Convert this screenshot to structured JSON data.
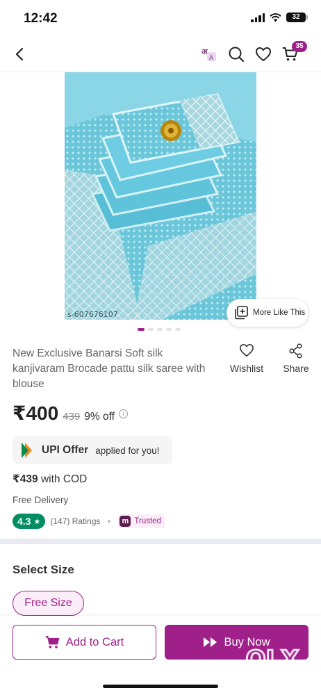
{
  "status_bar": {
    "time": "12:42",
    "battery": "32"
  },
  "header": {
    "cart_count": "35",
    "lang_icon": "language-icon"
  },
  "image": {
    "code": "s-607676107",
    "more_like_label": "More Like This"
  },
  "carousel": {
    "count": 5,
    "active": 0
  },
  "product": {
    "title": "New Exclusive Banarsi Soft silk kanjivaram Brocade pattu silk saree with blouse",
    "price": "₹400",
    "mrp": "439",
    "discount": "9% off"
  },
  "actions": {
    "wishlist": "Wishlist",
    "share": "Share"
  },
  "upi": {
    "title": "UPI Offer",
    "subtitle": "applied for you!"
  },
  "cod": {
    "price": "₹439",
    "label": "with COD"
  },
  "delivery": "Free Delivery",
  "rating": {
    "value": "4.3",
    "count": "(147) Ratings",
    "trusted": "Trusted",
    "trusted_logo": "m"
  },
  "size": {
    "heading": "Select Size",
    "selected": "Free Size"
  },
  "bottom": {
    "add_to_cart": "Add to Cart",
    "buy_now": "Buy Now"
  },
  "watermark": "OLX",
  "colors": {
    "brand": "#9f2089",
    "rating_green": "#038d63",
    "saree": "#7ccfe0"
  }
}
